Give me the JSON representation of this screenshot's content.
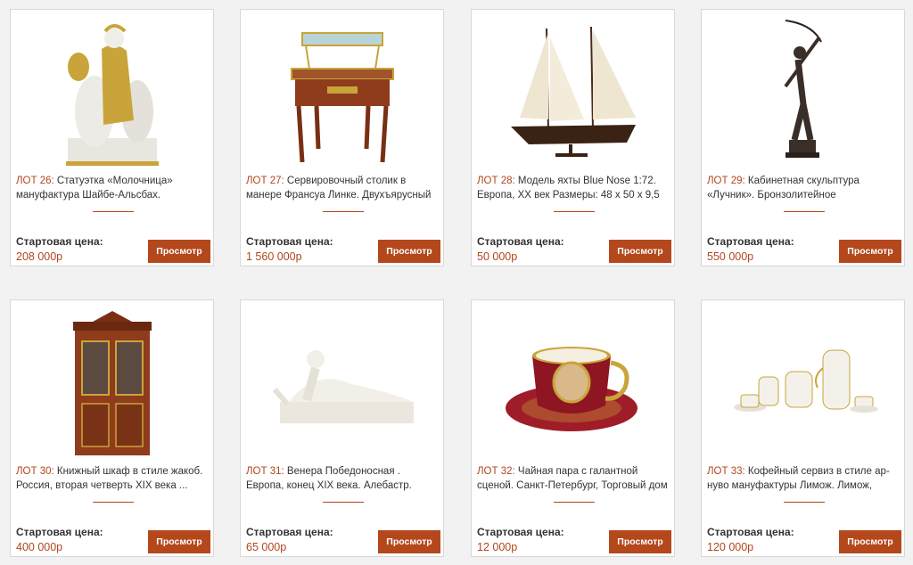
{
  "start_price_label": "Стартовая цена:",
  "view_button_label": "Просмотр",
  "accent_color": "#b4481c",
  "lots": [
    {
      "lot": "ЛОТ 26:",
      "title": "Статуэтка «Молочница» мануфактура Шайбе-Альсбах.",
      "price": "208 000р",
      "image": "porcelain-figurine-image"
    },
    {
      "lot": "ЛОТ 27:",
      "title": "Сервировочный столик в манере Франсуа Линке. Двухъярусный",
      "price": "1 560 000р",
      "image": "serving-table-image"
    },
    {
      "lot": "ЛОТ 28:",
      "title": "Модель яхты Blue Nose 1:72. Европа, XX век Размеры: 48 x 50 x 9,5 ...",
      "price": "50 000р",
      "image": "yacht-model-image"
    },
    {
      "lot": "ЛОТ 29:",
      "title": "Кабинетная скульптура «Лучник». Бронзолитейное предприятие",
      "price": "550 000р",
      "image": "archer-sculpture-image"
    },
    {
      "lot": "ЛОТ 30:",
      "title": "Книжный шкаф в стиле жакоб. Россия, вторая четверть XIX века ...",
      "price": "400 000р",
      "image": "bookcase-image"
    },
    {
      "lot": "ЛОТ 31:",
      "title": "Венера Победоносная . Европа, конец XIX века. Алебастр.",
      "price": "65 000р",
      "image": "venus-sculpture-image"
    },
    {
      "lot": "ЛОТ 32:",
      "title": "Чайная пара с галантной сценой. Санкт-Петербург, Торговый дом",
      "price": "12 000р",
      "image": "tea-cup-image"
    },
    {
      "lot": "ЛОТ 33:",
      "title": "Кофейный сервиз в стиле ар-нуво мануфактуры Лимож. Лимож,",
      "price": "120 000р",
      "image": "coffee-set-image"
    }
  ]
}
